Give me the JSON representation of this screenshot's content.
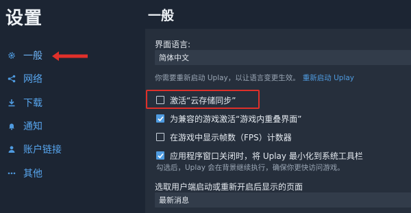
{
  "sidebar": {
    "title": "设置",
    "items": [
      {
        "label": "一般",
        "icon": "gear-icon"
      },
      {
        "label": "网络",
        "icon": "network-icon"
      },
      {
        "label": "下载",
        "icon": "download-icon"
      },
      {
        "label": "通知",
        "icon": "bell-icon"
      },
      {
        "label": "账户链接",
        "icon": "user-icon"
      },
      {
        "label": "其他",
        "icon": "more-icon"
      }
    ]
  },
  "main": {
    "title": "一般",
    "language": {
      "label": "界面语言:",
      "value": "简体中文",
      "hint": "你需要重新启动 Uplay，以让语言变更生效。",
      "restart_link": "重新启动 Uplay"
    },
    "checkboxes": [
      {
        "label": "激活“云存储同步”",
        "checked": false
      },
      {
        "label": "为兼容的游戏激活“游戏内重叠界面”",
        "checked": true
      },
      {
        "label": "在游戏中显示帧数（FPS）计数器",
        "checked": false
      },
      {
        "label": "应用程序窗口关闭时，将 Uplay 最小化到系统工具栏",
        "checked": true,
        "hint": "勾选后，Uplay 会在背景继续执行，确保你更快访问游戏。"
      }
    ],
    "startup_page": {
      "label": "选取用户端启动或重新开启后显示的页面",
      "value": "最新消息"
    }
  },
  "colors": {
    "accent": "#4f9be0",
    "highlight": "#e0302a",
    "background": "#1c2533",
    "panel": "#262f3c"
  }
}
